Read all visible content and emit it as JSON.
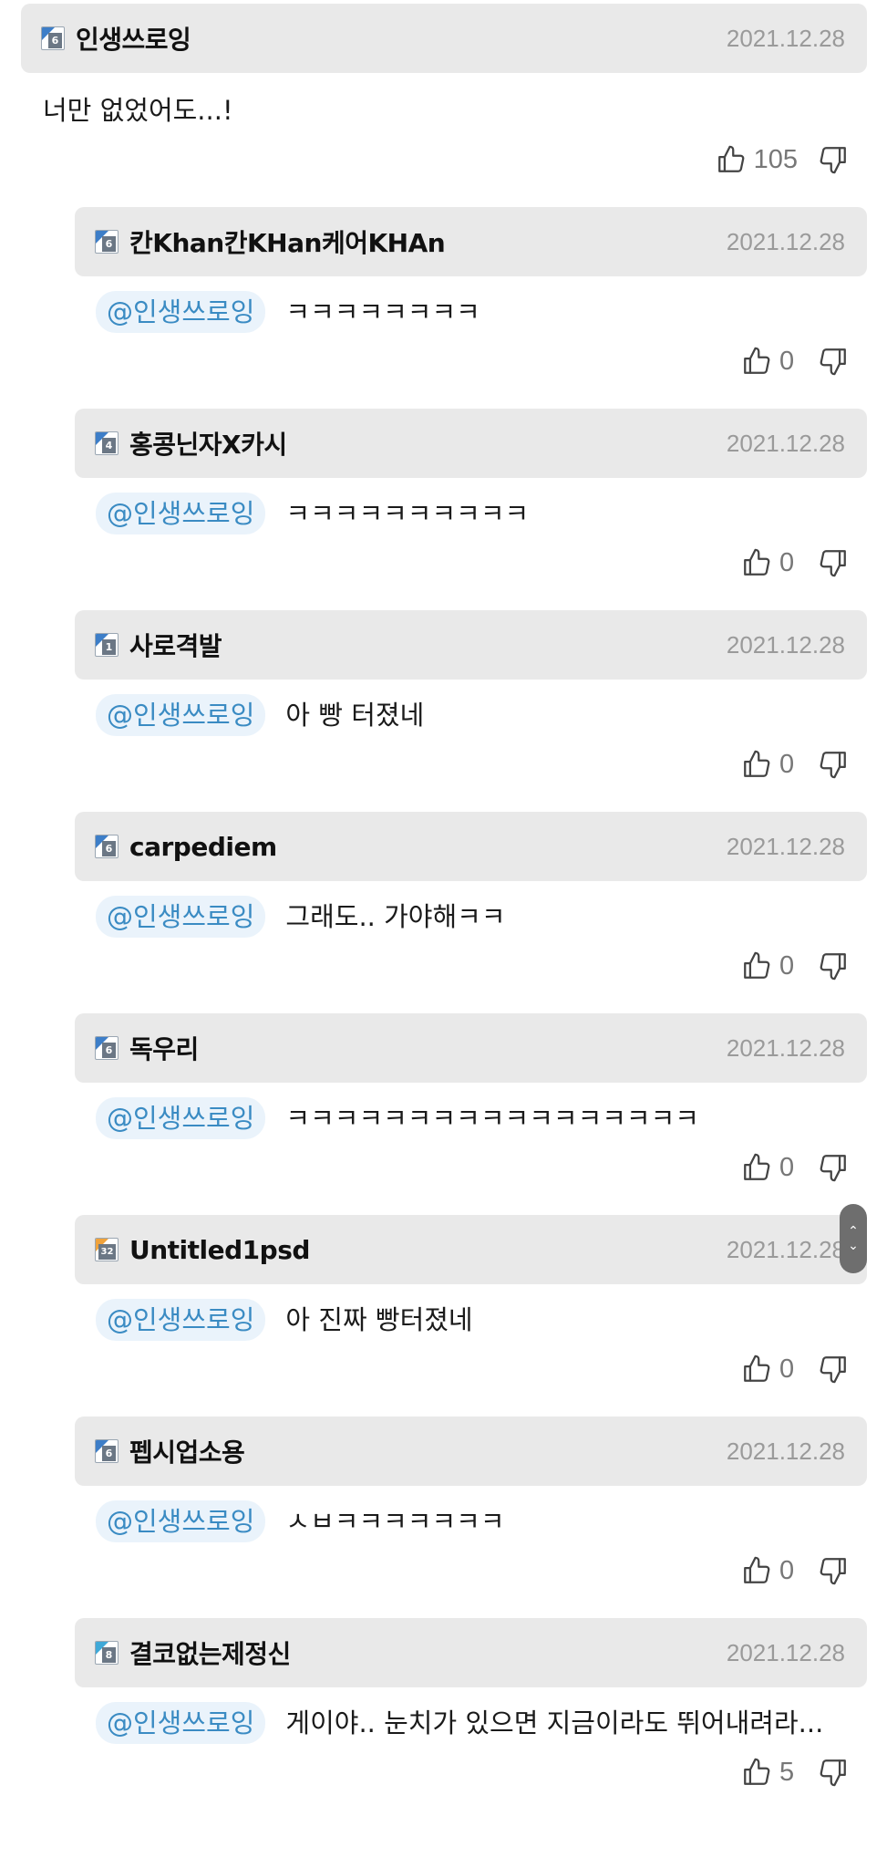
{
  "comments": [
    {
      "type": "top",
      "level": "6",
      "level_color": "blue",
      "username": "인생쓰로잉",
      "date": "2021.12.28",
      "mention": "",
      "text": "너만 없었어도...!",
      "likes": "105"
    },
    {
      "type": "reply",
      "level": "6",
      "level_color": "blue",
      "username": "칸Khan칸KHan케어KHAn",
      "date": "2021.12.28",
      "mention": "@인생쓰로잉",
      "text": "ㅋㅋㅋㅋㅋㅋㅋㅋ",
      "likes": "0"
    },
    {
      "type": "reply",
      "level": "4",
      "level_color": "blue",
      "username": "홍콩닌자X카시",
      "date": "2021.12.28",
      "mention": "@인생쓰로잉",
      "text": "ㅋㅋㅋㅋㅋㅋㅋㅋㅋㅋ",
      "likes": "0"
    },
    {
      "type": "reply",
      "level": "1",
      "level_color": "blue",
      "username": "사로격발",
      "date": "2021.12.28",
      "mention": "@인생쓰로잉",
      "text": "아 빵 터졌네",
      "likes": "0"
    },
    {
      "type": "reply",
      "level": "6",
      "level_color": "blue",
      "username": "carpediem",
      "date": "2021.12.28",
      "mention": "@인생쓰로잉",
      "text": "그래도.. 가야해ㅋㅋ",
      "likes": "0"
    },
    {
      "type": "reply",
      "level": "6",
      "level_color": "blue",
      "username": "독우리",
      "date": "2021.12.28",
      "mention": "@인생쓰로잉",
      "text": "ㅋㅋㅋㅋㅋㅋㅋㅋㅋㅋㅋㅋㅋㅋㅋㅋㅋ",
      "likes": "0"
    },
    {
      "type": "reply",
      "level": "32",
      "level_color": "orange",
      "username": "Untitled1psd",
      "date": "2021.12.28",
      "mention": "@인생쓰로잉",
      "text": "아 진짜 빵터졌네",
      "likes": "0"
    },
    {
      "type": "reply",
      "level": "6",
      "level_color": "blue",
      "username": "펩시업소용",
      "date": "2021.12.28",
      "mention": "@인생쓰로잉",
      "text": "ㅅㅂㅋㅋㅋㅋㅋㅋㅋ",
      "likes": "0"
    },
    {
      "type": "reply",
      "level": "8",
      "level_color": "cyan",
      "username": "결코없는제정신",
      "date": "2021.12.28",
      "mention": "@인생쓰로잉",
      "text": "게이야.. 눈치가 있으면 지금이라도 뛰어내려라...",
      "likes": "5"
    }
  ],
  "icons": {
    "like": "thumbs-up-icon",
    "dislike": "thumbs-down-icon",
    "scroll_up": "chevron-up-icon",
    "scroll_down": "chevron-down-icon"
  },
  "colors": {
    "mention_bg": "#eaf3fb",
    "mention_text": "#3a8bc3",
    "header_bg": "#e9e9e9",
    "date": "#9a9a9a"
  }
}
